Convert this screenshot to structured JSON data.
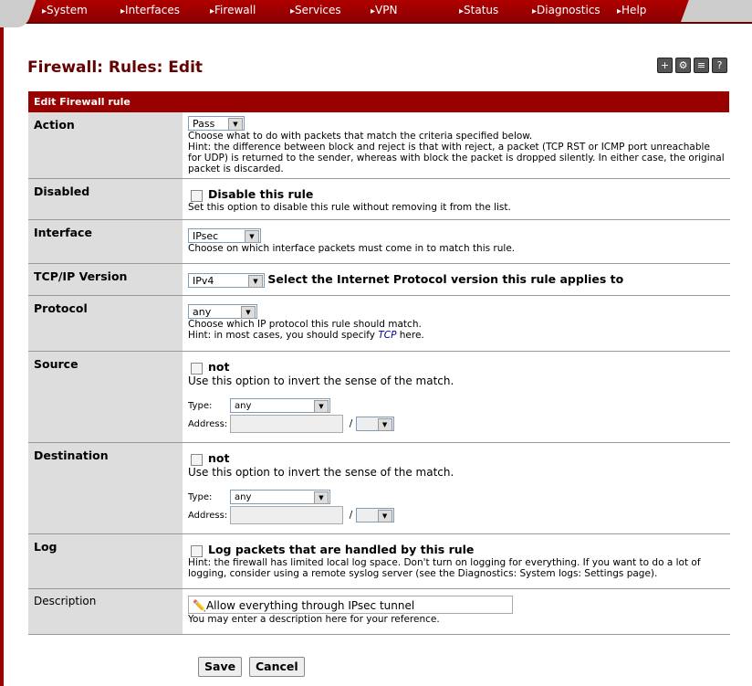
{
  "nav": [
    "System",
    "Interfaces",
    "Firewall",
    "Services",
    "VPN",
    "Status",
    "Diagnostics",
    "Help"
  ],
  "title": "Firewall: Rules: Edit",
  "section": "Edit Firewall rule",
  "rows": {
    "action": {
      "label": "Action",
      "value": "Pass",
      "help1": "Choose what to do with packets that match the criteria specified below.",
      "help2": "Hint: the difference between block and reject is that with reject, a packet (TCP RST or ICMP port unreachable for UDP) is returned to the sender, whereas with block the packet is dropped silently. In either case, the original packet is discarded."
    },
    "disabled": {
      "label": "Disabled",
      "check": "Disable this rule",
      "help": "Set this option to disable this rule without removing it from the list."
    },
    "interface": {
      "label": "Interface",
      "value": "IPsec",
      "help": "Choose on which interface packets must come in to match this rule."
    },
    "ipver": {
      "label": "TCP/IP Version",
      "value": "IPv4",
      "help": "Select the Internet Protocol version this rule applies to"
    },
    "protocol": {
      "label": "Protocol",
      "value": "any",
      "help1": "Choose which IP protocol this rule should match.",
      "help2a": "Hint: in most cases, you should specify ",
      "help2b": "TCP",
      "help2c": " here."
    },
    "source": {
      "label": "Source",
      "check": "not",
      "help": "Use this option to invert the sense of the match.",
      "type_label": "Type:",
      "type": "any",
      "addr_label": "Address:",
      "slash": "/"
    },
    "destination": {
      "label": "Destination",
      "check": "not",
      "help": "Use this option to invert the sense of the match.",
      "type_label": "Type:",
      "type": "any",
      "addr_label": "Address:",
      "slash": "/"
    },
    "log": {
      "label": "Log",
      "check": "Log packets that are handled by this rule",
      "help": "Hint: the firewall has limited local log space. Don't turn on logging for everything. If you want to do a lot of logging, consider using a remote syslog server (see the Diagnostics: System logs: Settings page)."
    },
    "description": {
      "label": "Description",
      "value": "Allow everything through IPsec tunnel",
      "help": "You may enter a description here for your reference."
    }
  },
  "buttons": {
    "save": "Save",
    "cancel": "Cancel"
  }
}
